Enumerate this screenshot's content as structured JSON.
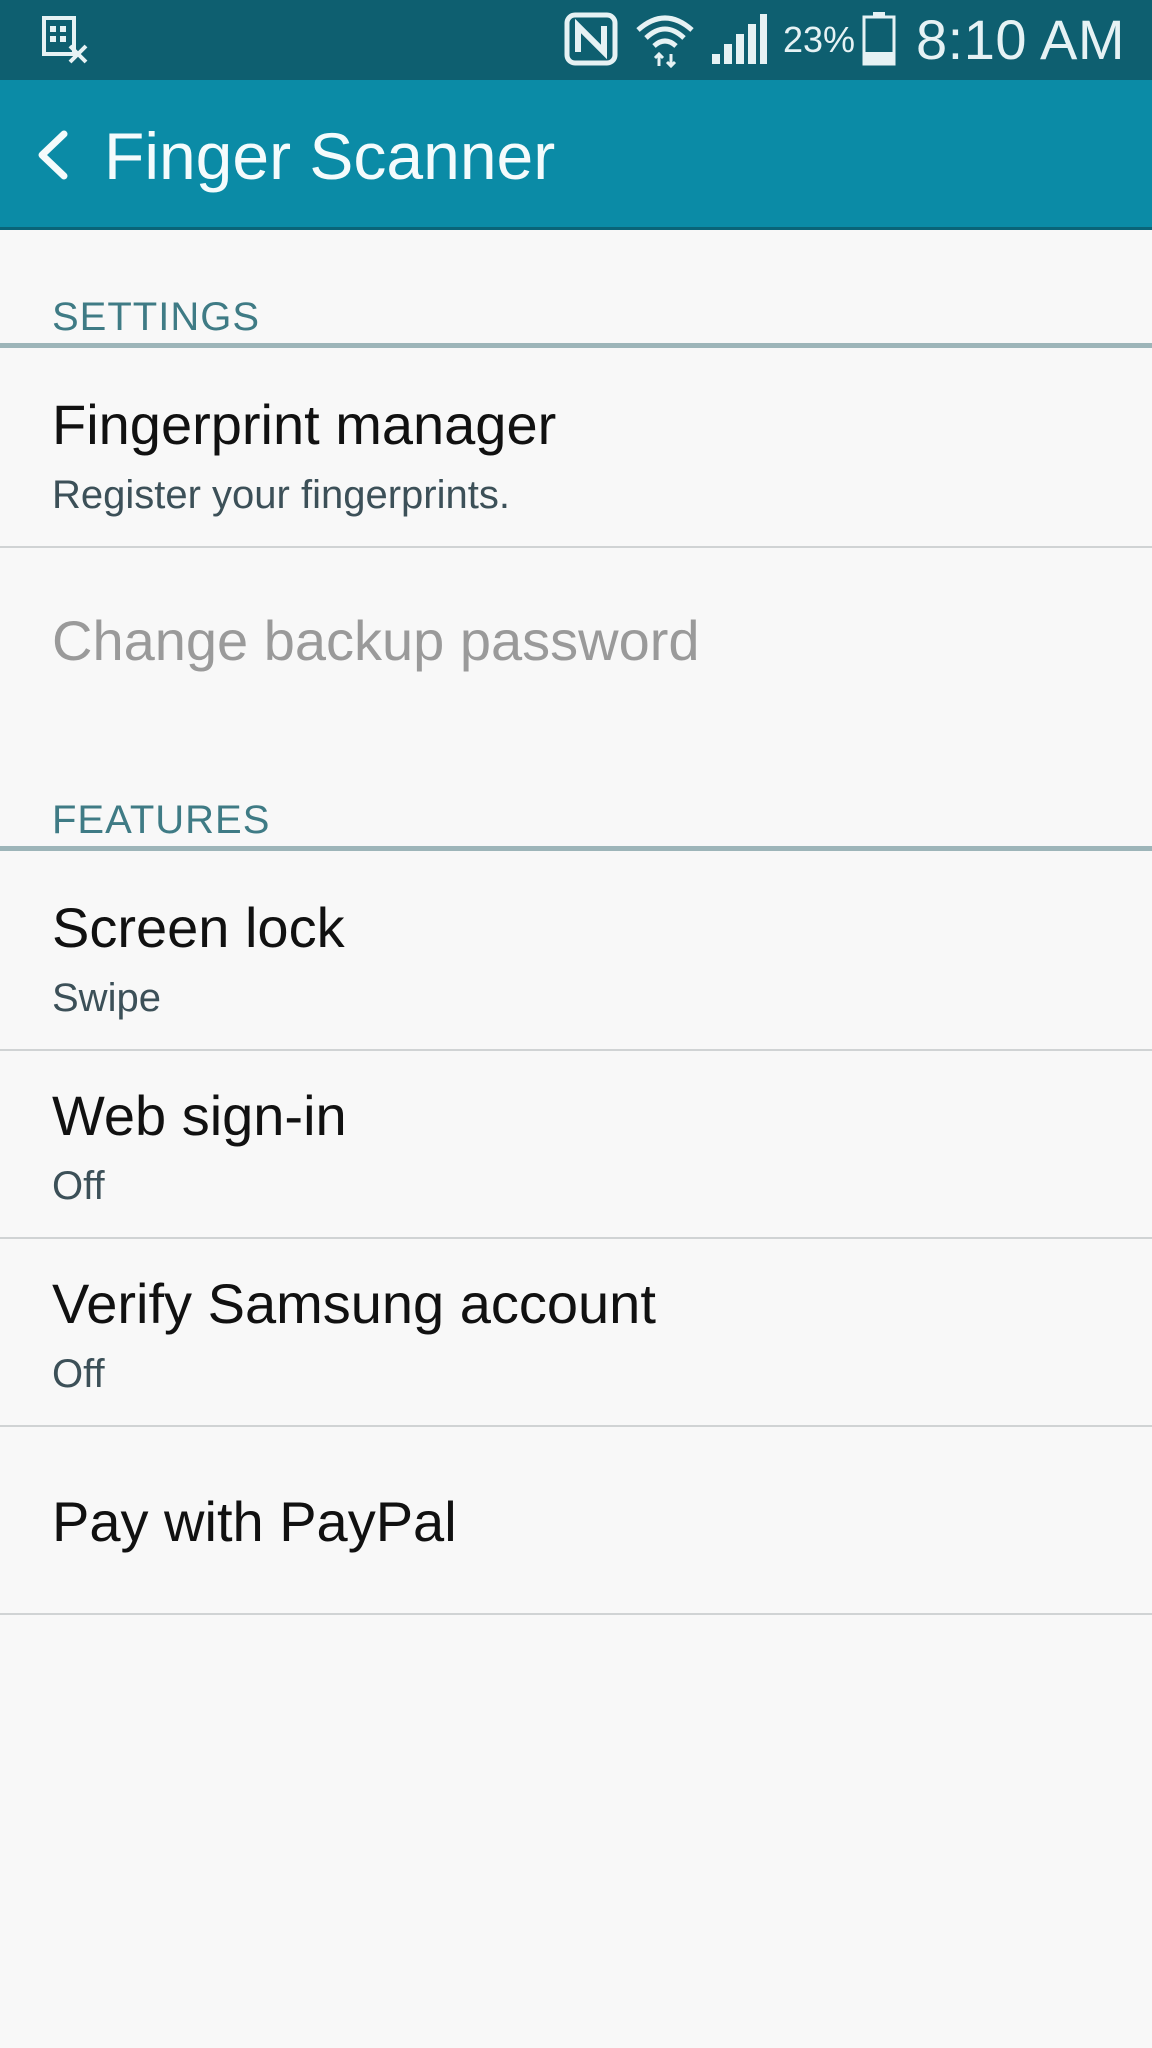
{
  "status_bar": {
    "left_icon": "screenshot-notification-icon",
    "icons": [
      "nfc-icon",
      "wifi-icon",
      "signal-icon",
      "battery-icon"
    ],
    "battery_percent": "23%",
    "time": "8:10 AM"
  },
  "app_bar": {
    "back_icon": "chevron-left-icon",
    "title": "Finger Scanner"
  },
  "sections": {
    "settings": {
      "header": "SETTINGS",
      "fingerprint_manager": {
        "title": "Fingerprint manager",
        "subtitle": "Register your fingerprints."
      },
      "backup_password": {
        "title": "Change backup password"
      }
    },
    "features": {
      "header": "FEATURES",
      "screen_lock": {
        "title": "Screen lock",
        "subtitle": "Swipe"
      },
      "web_signin": {
        "title": "Web sign-in",
        "subtitle": "Off"
      },
      "verify_samsung": {
        "title": "Verify Samsung account",
        "subtitle": "Off"
      },
      "paypal": {
        "title": "Pay with PayPal"
      }
    }
  },
  "colors": {
    "status_bar": "#0e5f70",
    "app_bar": "#0b8ba6",
    "section_header": "#3f7b85",
    "background": "#f8f8f8"
  }
}
